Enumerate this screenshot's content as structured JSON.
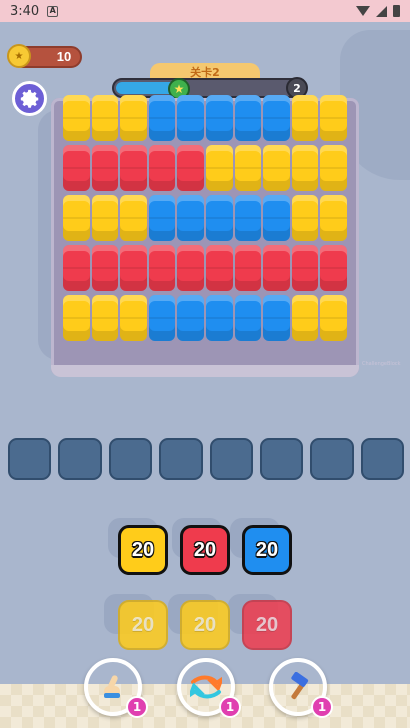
{
  "status_bar": {
    "time": "3:40",
    "notification_letter": "A"
  },
  "hud": {
    "coins": "10",
    "level_label": "关卡2",
    "next_level": "2",
    "progress_fraction": 0.33
  },
  "colors": {
    "yellow": "#ffcc1a",
    "blue": "#1f8ef0",
    "red": "#ef3b4d"
  },
  "board": {
    "rows": [
      [
        "yellow",
        "yellow",
        "yellow",
        "blue",
        "blue",
        "blue",
        "blue",
        "blue",
        "yellow",
        "yellow"
      ],
      [
        "red",
        "red",
        "red",
        "red",
        "red",
        "yellow",
        "yellow",
        "yellow",
        "yellow",
        "yellow"
      ],
      [
        "yellow",
        "yellow",
        "yellow",
        "blue",
        "blue",
        "blue",
        "blue",
        "blue",
        "yellow",
        "yellow"
      ],
      [
        "red",
        "red",
        "red",
        "red",
        "red",
        "red",
        "red",
        "red",
        "red",
        "red"
      ],
      [
        "yellow",
        "yellow",
        "yellow",
        "blue",
        "blue",
        "blue",
        "blue",
        "blue",
        "yellow",
        "yellow"
      ]
    ]
  },
  "slots": {
    "count": 8
  },
  "queue": {
    "active": [
      {
        "color": "yellow",
        "value": "20"
      },
      {
        "color": "red",
        "value": "20"
      },
      {
        "color": "blue",
        "value": "20"
      }
    ],
    "waiting": [
      {
        "color": "yellow",
        "value": "20"
      },
      {
        "color": "yellow",
        "value": "20"
      },
      {
        "color": "red",
        "value": "20"
      }
    ]
  },
  "boosters": [
    {
      "name": "finger-tap",
      "icon": "finger-icon",
      "count": "1",
      "color": "#6a4fd1"
    },
    {
      "name": "shuffle",
      "icon": "shuffle-icon",
      "count": "1",
      "color": "#3f69d9"
    },
    {
      "name": "hammer",
      "icon": "hammer-icon",
      "count": "1",
      "color": "#2fb06a"
    }
  ]
}
